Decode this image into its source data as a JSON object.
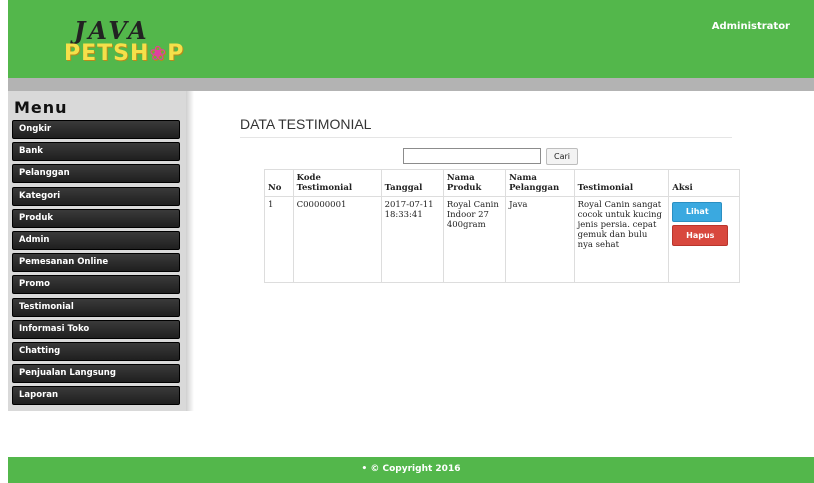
{
  "header": {
    "logo_top": "JAVA",
    "logo_bottom": "PETSH",
    "logo_bottom_end": "P",
    "user": "Administrator"
  },
  "sidebar": {
    "title": "Menu",
    "items": [
      {
        "label": "Ongkir"
      },
      {
        "label": "Bank"
      },
      {
        "label": "Pelanggan"
      },
      {
        "label": "Kategori"
      },
      {
        "label": "Produk"
      },
      {
        "label": "Admin"
      },
      {
        "label": "Pemesanan Online"
      },
      {
        "label": "Promo"
      },
      {
        "label": "Testimonial"
      },
      {
        "label": "Informasi Toko"
      },
      {
        "label": "Chatting"
      },
      {
        "label": "Penjualan Langsung"
      },
      {
        "label": "Laporan"
      }
    ]
  },
  "main": {
    "title": "DATA TESTIMONIAL",
    "search": {
      "value": "",
      "button": "Cari"
    },
    "table": {
      "headers": [
        "No",
        "Kode Testimonial",
        "Tanggal",
        "Nama Produk",
        "Nama Pelanggan",
        "Testimonial",
        "Aksi"
      ],
      "rows": [
        {
          "no": "1",
          "kode": "C00000001",
          "tanggal": "2017-07-11 18:33:41",
          "produk": "Royal Canin Indoor 27 400gram",
          "pelanggan": "Java",
          "testimonial": "Royal Canin sangat cocok untuk kucing jenis persia. cepat gemuk dan bulu nya sehat",
          "lihat": "Lihat",
          "hapus": "Hapus"
        }
      ]
    }
  },
  "footer": {
    "text": "• © Copyright 2016"
  },
  "colors": {
    "header_green": "#53b74b",
    "button_blue": "#3aa9e0",
    "button_red": "#d8483e"
  },
  "icons": {
    "logo_paw": "paw-icon"
  }
}
